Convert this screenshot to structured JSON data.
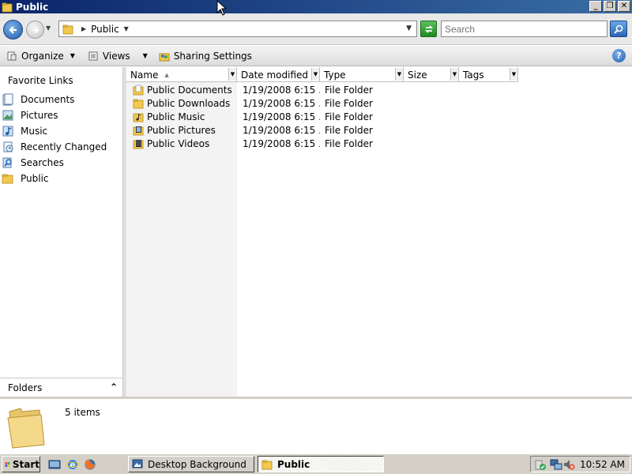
{
  "window": {
    "title": "Public",
    "minimize_label": "_",
    "maximize_label": "❐",
    "close_label": "✕"
  },
  "address": {
    "crumb": "Public",
    "search_placeholder": "Search"
  },
  "toolbar": {
    "organize": "Organize",
    "views": "Views",
    "sharing": "Sharing Settings",
    "help": "?"
  },
  "nav": {
    "header": "Favorite Links",
    "items": [
      {
        "label": "Documents",
        "icon": "documents-icon"
      },
      {
        "label": "Pictures",
        "icon": "pictures-icon"
      },
      {
        "label": "Music",
        "icon": "music-icon"
      },
      {
        "label": "Recently Changed",
        "icon": "recently-changed-icon"
      },
      {
        "label": "Searches",
        "icon": "searches-icon"
      },
      {
        "label": "Public",
        "icon": "folder-icon"
      }
    ],
    "folders_label": "Folders",
    "folders_chevron": "⌃"
  },
  "columns": {
    "name": "Name",
    "date": "Date modified",
    "type": "Type",
    "size": "Size",
    "tags": "Tags"
  },
  "files": [
    {
      "name": "Public Documents",
      "date": "1/19/2008 6:15 ...",
      "type": "File Folder",
      "icon": "folder-documents-icon"
    },
    {
      "name": "Public Downloads",
      "date": "1/19/2008 6:15 ...",
      "type": "File Folder",
      "icon": "folder-downloads-icon"
    },
    {
      "name": "Public Music",
      "date": "1/19/2008 6:15 ...",
      "type": "File Folder",
      "icon": "folder-music-icon"
    },
    {
      "name": "Public Pictures",
      "date": "1/19/2008 6:15 ...",
      "type": "File Folder",
      "icon": "folder-pictures-icon"
    },
    {
      "name": "Public Videos",
      "date": "1/19/2008 6:15 ...",
      "type": "File Folder",
      "icon": "folder-videos-icon"
    }
  ],
  "details": {
    "count": "5 items"
  },
  "taskbar": {
    "start": "Start",
    "tasks": [
      "Desktop Background",
      "Public"
    ],
    "clock": "10:52 AM"
  },
  "colors": {
    "titlebar_start": "#0a246a",
    "titlebar_end": "#3a6ea5",
    "folder_yellow": "#f2c94c",
    "taskbar_gray": "#d4d0c8"
  }
}
